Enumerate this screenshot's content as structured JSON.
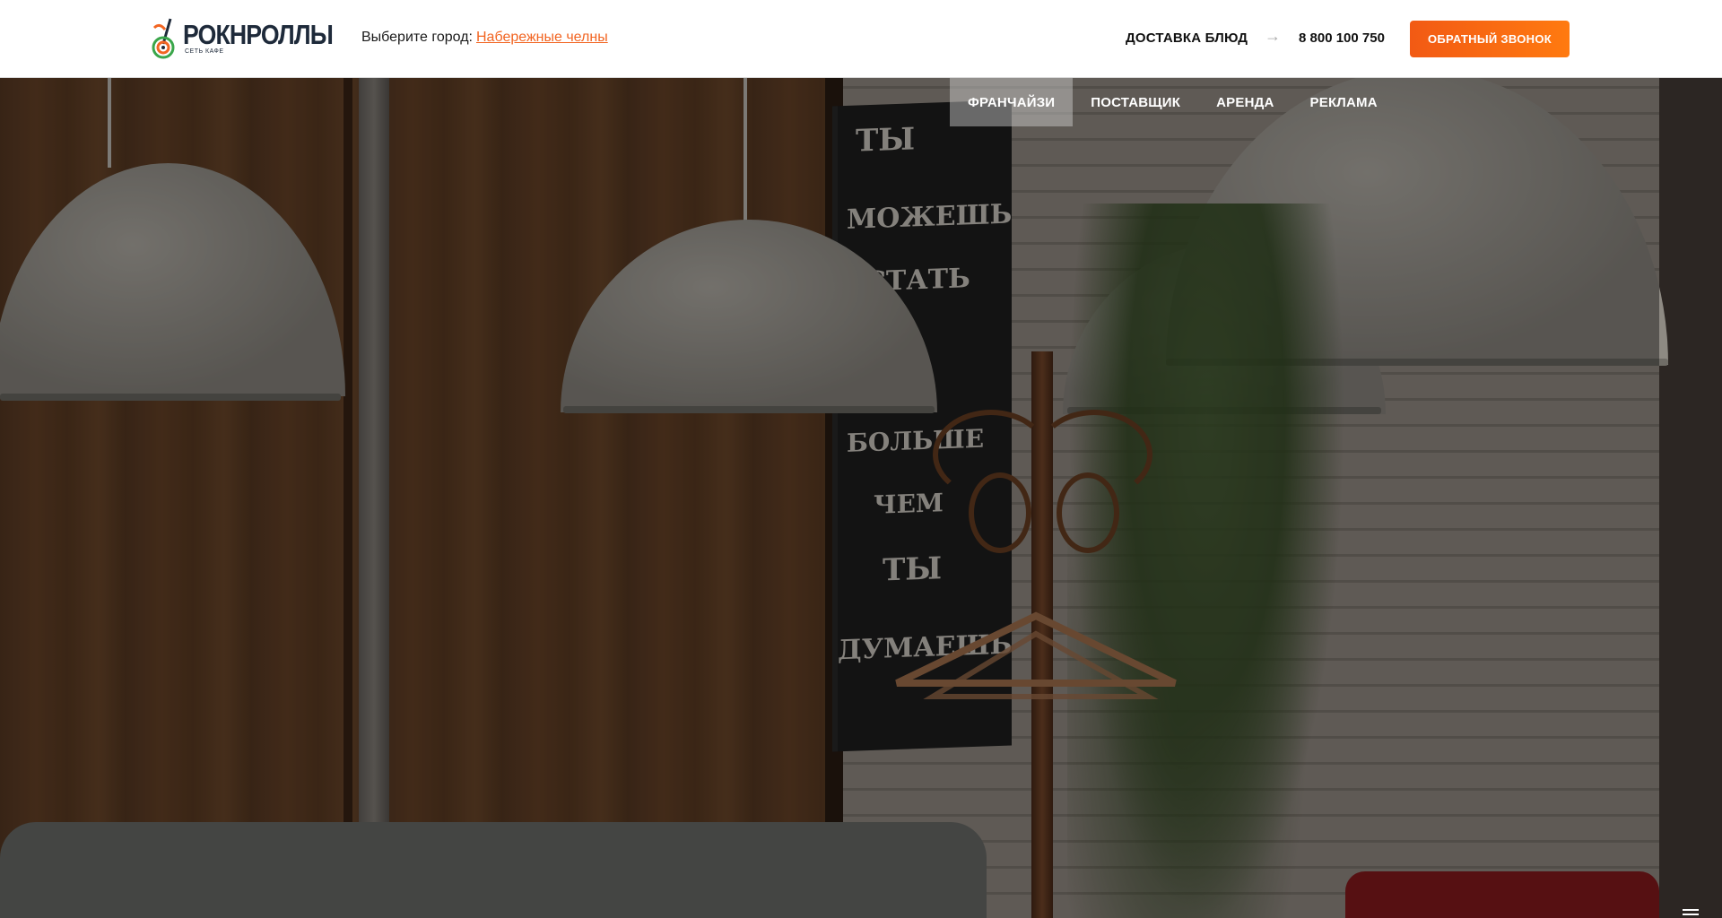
{
  "header": {
    "logo": {
      "title": "РОКНРОЛЛЫ",
      "subtitle": "СЕТЬ КАФЕ"
    },
    "city": {
      "label": "Выберите город:",
      "value": "Набережные челны"
    },
    "delivery_label": "ДОСТАВКА БЛЮД",
    "arrow_icon": "arrow-right-icon",
    "phone": "8 800 100 750",
    "callback_label": "ОБРАТНЫЙ ЗВОНОК"
  },
  "subnav": {
    "items": [
      {
        "label": "ФРАНЧАЙЗИ",
        "active": true
      },
      {
        "label": "ПОСТАВЩИК",
        "active": false
      },
      {
        "label": "АРЕНДА",
        "active": false
      },
      {
        "label": "РЕКЛАМА",
        "active": false
      }
    ]
  },
  "hero": {
    "chalkboard_text": [
      "ТЫ",
      "МОЖЕШЬ",
      "СТАТЬ",
      "БОЛЬШЕ",
      "ЧЕМ",
      "ТЫ",
      "ДУМАЕШЬ"
    ]
  },
  "menu_icon": "hamburger-icon",
  "colors": {
    "accent": "#f26522",
    "button": "#ff6a14",
    "text_dark": "#1e2a3a"
  }
}
